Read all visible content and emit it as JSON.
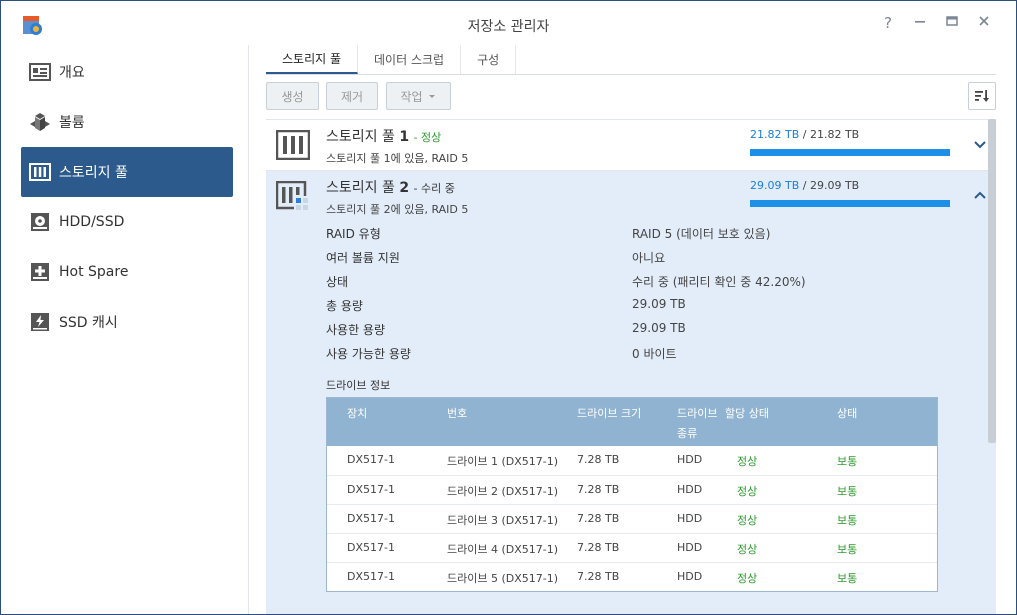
{
  "window": {
    "title": "저장소 관리자"
  },
  "sidebar": {
    "items": [
      {
        "label": "개요",
        "icon": "overview-icon"
      },
      {
        "label": "볼륨",
        "icon": "volume-icon"
      },
      {
        "label": "스토리지 풀",
        "icon": "storage-pool-icon",
        "active": true
      },
      {
        "label": "HDD/SSD",
        "icon": "hdd-icon"
      },
      {
        "label": "Hot Spare",
        "icon": "hot-spare-icon"
      },
      {
        "label": "SSD 캐시",
        "icon": "ssd-cache-icon"
      }
    ]
  },
  "tabs": [
    {
      "label": "스토리지 풀",
      "active": true
    },
    {
      "label": "데이터 스크럽"
    },
    {
      "label": "구성"
    }
  ],
  "toolbar": {
    "create": "생성",
    "remove": "제거",
    "action": "작업"
  },
  "pools": [
    {
      "name": "스토리지 풀",
      "number": "1",
      "status": "- 정상",
      "sub": "스토리지 풀 1에 있음, RAID 5",
      "used": "21.82 TB",
      "total": "/ 21.82 TB",
      "fill": 1.0
    },
    {
      "name": "스토리지 풀",
      "number": "2",
      "status": "- 수리 중",
      "sub": "스토리지 풀 2에 있음, RAID 5",
      "used": "29.09 TB",
      "total": "/ 29.09 TB",
      "fill": 1.0
    }
  ],
  "details": [
    {
      "label": "RAID 유형",
      "value": "RAID 5 (데이터 보호 있음)"
    },
    {
      "label": "여러 볼륨 지원",
      "value": "아니요"
    },
    {
      "label": "상태",
      "value": "수리 중 (패리티 확인 중 42.20%)"
    },
    {
      "label": "총 용량",
      "value": "29.09 TB"
    },
    {
      "label": "사용한 용량",
      "value": "29.09 TB"
    },
    {
      "label": "사용 가능한 용량",
      "value": "0 바이트"
    }
  ],
  "drive_info": {
    "title": "드라이브 정보",
    "headers": [
      "장치",
      "번호",
      "드라이브 크기",
      "드라이브 종류",
      "할당 상태",
      "상태"
    ],
    "rows": [
      [
        "DX517-1",
        "드라이브 1 (DX517-1)",
        "7.28 TB",
        "HDD",
        "정상",
        "보통"
      ],
      [
        "DX517-1",
        "드라이브 2 (DX517-1)",
        "7.28 TB",
        "HDD",
        "정상",
        "보통"
      ],
      [
        "DX517-1",
        "드라이브 3 (DX517-1)",
        "7.28 TB",
        "HDD",
        "정상",
        "보통"
      ],
      [
        "DX517-1",
        "드라이브 4 (DX517-1)",
        "7.28 TB",
        "HDD",
        "정상",
        "보통"
      ],
      [
        "DX517-1",
        "드라이브 5 (DX517-1)",
        "7.28 TB",
        "HDD",
        "정상",
        "보통"
      ]
    ]
  },
  "colors": {
    "accent": "#2d5a8c",
    "ok": "#2e9a2e",
    "bar": "#1e90e8",
    "table_header": "#90b3d1"
  }
}
